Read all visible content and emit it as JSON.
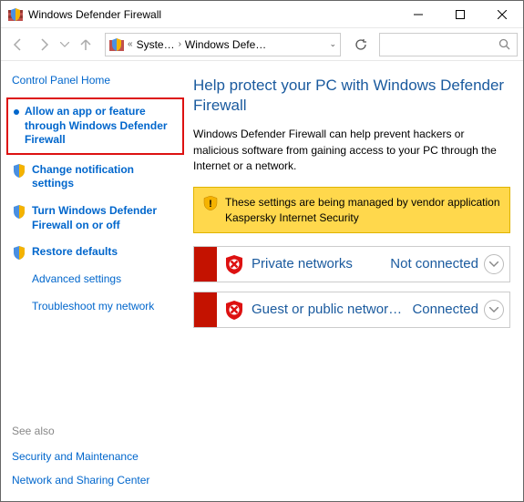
{
  "window": {
    "title": "Windows Defender Firewall"
  },
  "breadcrumb": {
    "item1": "Syste…",
    "item2": "Windows Defe…"
  },
  "sidebar": {
    "home": "Control Panel Home",
    "allow": "Allow an app or feature through Windows Defender Firewall",
    "notify": "Change notification settings",
    "onoff": "Turn Windows Defender Firewall on or off",
    "restore": "Restore defaults",
    "advanced": "Advanced settings",
    "troubleshoot": "Troubleshoot my network",
    "seeAlso": "See also",
    "secMaint": "Security and Maintenance",
    "netShare": "Network and Sharing Center"
  },
  "main": {
    "heading": "Help protect your PC with Windows Defender Firewall",
    "desc": "Windows Defender Firewall can help prevent hackers or malicious software from gaining access to your PC through the Internet or a network.",
    "warning": "These settings are being managed by vendor application Kaspersky Internet Security",
    "net1": {
      "label": "Private networks",
      "status": "Not connected"
    },
    "net2": {
      "label": "Guest or public networ…",
      "status": "Connected"
    }
  }
}
